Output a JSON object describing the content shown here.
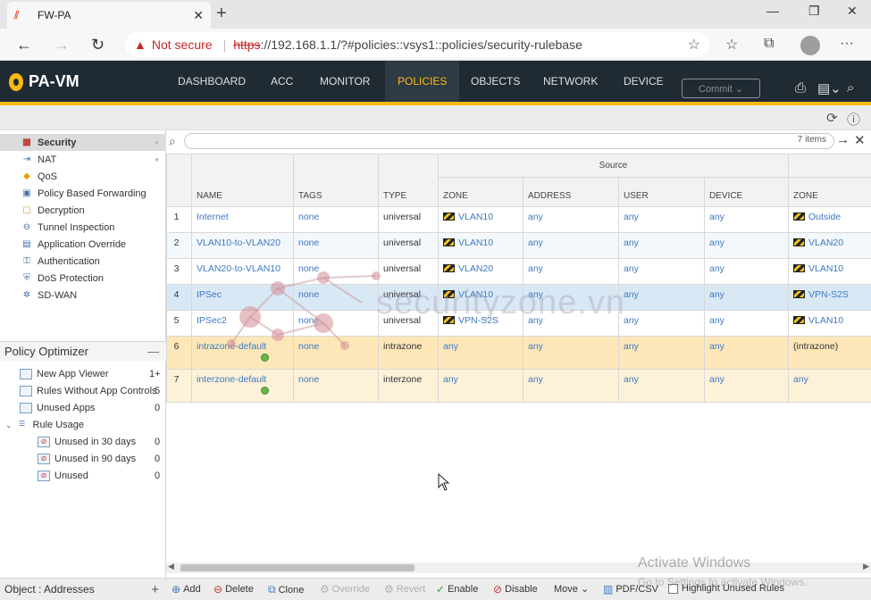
{
  "browser": {
    "tab_title": "FW-PA",
    "not_secure": "Not secure",
    "url_scheme": "https",
    "url_rest": "://192.168.1.1/?#policies::vsys1::policies/security-rulebase"
  },
  "app": {
    "logo": "PA-VM",
    "nav": [
      "DASHBOARD",
      "ACC",
      "MONITOR",
      "POLICIES",
      "OBJECTS",
      "NETWORK",
      "DEVICE"
    ],
    "active_nav": "POLICIES",
    "commit_label": "Commit ⌄",
    "accent_color": "#fdb913",
    "header_color": "#202a32"
  },
  "sidebar": {
    "items": [
      {
        "label": "Security",
        "icon": "security-rule-icon"
      },
      {
        "label": "NAT",
        "icon": "nat-icon"
      },
      {
        "label": "QoS",
        "icon": "qos-icon"
      },
      {
        "label": "Policy Based Forwarding",
        "icon": "pbf-icon"
      },
      {
        "label": "Decryption",
        "icon": "lock-icon"
      },
      {
        "label": "Tunnel Inspection",
        "icon": "tunnel-icon"
      },
      {
        "label": "Application Override",
        "icon": "override-icon"
      },
      {
        "label": "Authentication",
        "icon": "auth-icon"
      },
      {
        "label": "DoS Protection",
        "icon": "dos-icon"
      },
      {
        "label": "SD-WAN",
        "icon": "sdwan-icon"
      }
    ],
    "selected": "Security"
  },
  "optimizer": {
    "title": "Policy Optimizer",
    "items": [
      {
        "label": "New App Viewer",
        "count": "1+"
      },
      {
        "label": "Rules Without App Controls",
        "count": "5"
      },
      {
        "label": "Unused Apps",
        "count": "0"
      },
      {
        "label": "Rule Usage",
        "count": ""
      },
      {
        "label": "Unused in 30 days",
        "count": "0"
      },
      {
        "label": "Unused in 90 days",
        "count": "0"
      },
      {
        "label": "Unused",
        "count": "0"
      }
    ],
    "object_bar": "Object : Addresses"
  },
  "table": {
    "item_count": "7 items",
    "group_header": "Source",
    "columns": [
      "",
      "NAME",
      "TAGS",
      "TYPE",
      "ZONE",
      "ADDRESS",
      "USER",
      "DEVICE",
      "ZONE"
    ],
    "rows": [
      {
        "num": "1",
        "name": "Internet",
        "tags": "none",
        "type": "universal",
        "src_zone": "VLAN10",
        "address": "any",
        "user": "any",
        "device": "any",
        "dst_zone": "Outside"
      },
      {
        "num": "2",
        "name": "VLAN10-to-VLAN20",
        "tags": "none",
        "type": "universal",
        "src_zone": "VLAN10",
        "address": "any",
        "user": "any",
        "device": "any",
        "dst_zone": "VLAN20"
      },
      {
        "num": "3",
        "name": "VLAN20-to-VLAN10",
        "tags": "none",
        "type": "universal",
        "src_zone": "VLAN20",
        "address": "any",
        "user": "any",
        "device": "any",
        "dst_zone": "VLAN10"
      },
      {
        "num": "4",
        "name": "IPSec",
        "tags": "none",
        "type": "universal",
        "src_zone": "VLAN10",
        "address": "any",
        "user": "any",
        "device": "any",
        "dst_zone": "VPN-S2S"
      },
      {
        "num": "5",
        "name": "IPSec2",
        "tags": "none",
        "type": "universal",
        "src_zone": "VPN-S2S",
        "address": "any",
        "user": "any",
        "device": "any",
        "dst_zone": "VLAN10"
      },
      {
        "num": "6",
        "name": "intrazone-default",
        "tags": "none",
        "type": "intrazone",
        "src_zone": "any",
        "address": "any",
        "user": "any",
        "device": "any",
        "dst_zone": "(intrazone)"
      },
      {
        "num": "7",
        "name": "interzone-default",
        "tags": "none",
        "type": "interzone",
        "src_zone": "any",
        "address": "any",
        "user": "any",
        "device": "any",
        "dst_zone": "any"
      }
    ]
  },
  "toolbar": {
    "add": "Add",
    "delete": "Delete",
    "clone": "Clone",
    "override": "Override",
    "revert": "Revert",
    "enable": "Enable",
    "disable": "Disable",
    "move": "Move ⌄",
    "pdf": "PDF/CSV",
    "highlight": "Highlight Unused Rules"
  },
  "overlays": {
    "watermark": "securityzone.vn",
    "activate_title": "Activate Windows",
    "activate_sub": "Go to Settings to activate Windows."
  }
}
